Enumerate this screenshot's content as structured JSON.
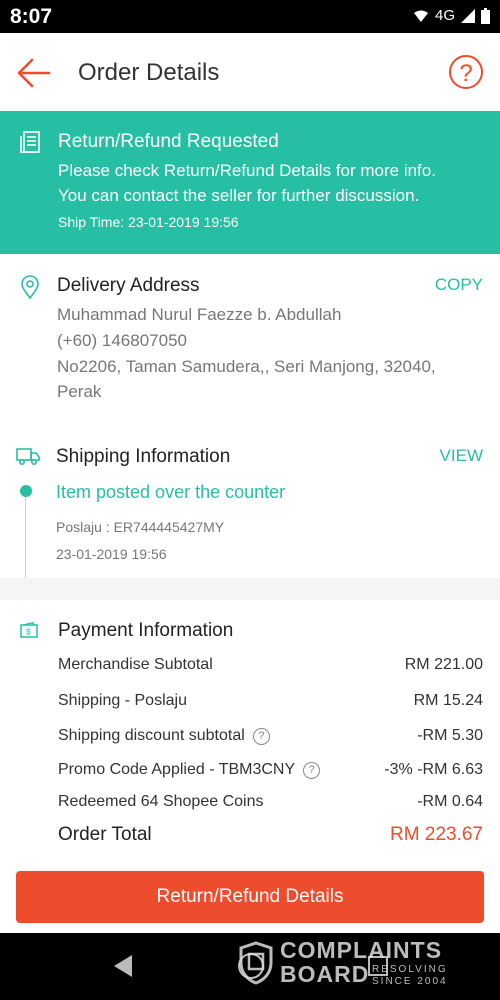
{
  "status_bar": {
    "time": "8:07",
    "network": "4G"
  },
  "header": {
    "title": "Order Details"
  },
  "banner": {
    "title": "Return/Refund Requested",
    "line1": "Please check Return/Refund Details for more info.",
    "line2": "You can contact the seller for further discussion.",
    "ship_time": "Ship Time: 23-01-2019 19:56"
  },
  "address": {
    "title": "Delivery Address",
    "copy_label": "COPY",
    "name": "Muhammad Nurul Faezze b. Abdullah",
    "phone": "(+60) 146807050",
    "line1": "No2206, Taman Samudera,, Seri Manjong, 32040,",
    "line2": "Perak"
  },
  "shipping": {
    "title": "Shipping Information",
    "view_label": "VIEW",
    "status": "Item posted over the counter",
    "courier": "Poslaju :  ER744445427MY",
    "time": "23-01-2019 19:56"
  },
  "payment": {
    "title": "Payment Information",
    "rows": [
      {
        "label": "Merchandise Subtotal",
        "value": "RM 221.00"
      },
      {
        "label": "Shipping - Poslaju",
        "value": "RM 15.24"
      },
      {
        "label": "Shipping discount subtotal",
        "value": "-RM 5.30"
      },
      {
        "label": "Promo Code Applied - TBM3CNY",
        "value": "-3% -RM 6.63"
      },
      {
        "label": "Redeemed 64 Shopee Coins",
        "value": "-RM 0.64"
      }
    ],
    "total_label": "Order Total",
    "total_value": "RM 223.67"
  },
  "footer": {
    "button_label": "Return/Refund Details"
  },
  "watermark": {
    "line1": "COMPLAINTS",
    "line2": "BOARD",
    "small1": "RESOLVING",
    "small2": "SINCE 2004"
  },
  "colors": {
    "accent": "#26bfa4",
    "brand": "#ee4d2d"
  },
  "icons": [
    "back-arrow-icon",
    "help-icon",
    "document-icon",
    "location-pin-icon",
    "truck-icon",
    "payment-icon",
    "question-icon"
  ]
}
